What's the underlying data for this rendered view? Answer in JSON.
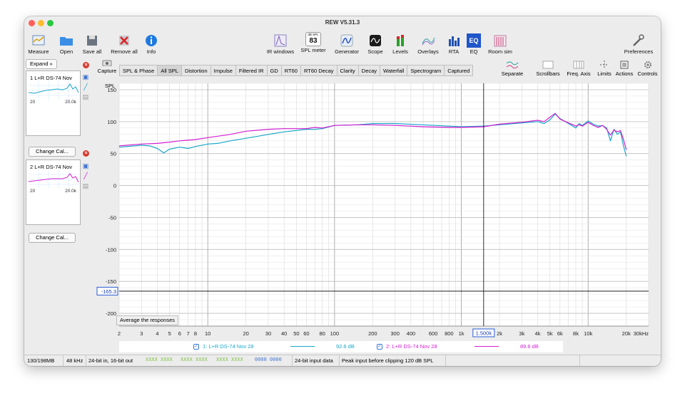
{
  "window": {
    "title": "REW V5.31.3"
  },
  "toolbar": {
    "measure": "Measure",
    "open": "Open",
    "save_all": "Save all",
    "remove_all": "Remove all",
    "info": "Info",
    "ir_windows": "IR windows",
    "spl_meter": "SPL meter",
    "spl_badge_label": "dB SPL",
    "spl_value": "83",
    "generator": "Generator",
    "scope": "Scope",
    "levels": "Levels",
    "overlays": "Overlays",
    "rta": "RTA",
    "eq": "EQ",
    "eq_icon_text": "EQ",
    "room_sim": "Room sim",
    "preferences": "Preferences"
  },
  "left_panel": {
    "expand": "Expand »",
    "measurements": [
      {
        "name": "1 L+R DS-74 Nov",
        "x_min": "20",
        "x_max": "20.0k",
        "change_cal": "Change Cal...",
        "color": "#1aa7c9"
      },
      {
        "name": "2 L+R DS-74 Nov",
        "x_min": "20",
        "x_max": "20.0k",
        "change_cal": "Change Cal...",
        "color": "#d21fd1"
      }
    ]
  },
  "tabs": {
    "capture": "Capture",
    "items": [
      "SPL & Phase",
      "All SPL",
      "Distortion",
      "Impulse",
      "Filtered IR",
      "GD",
      "RT60",
      "RT60 Decay",
      "Clarity",
      "Decay",
      "Waterfall",
      "Spectrogram",
      "Captured"
    ],
    "selected": "All SPL"
  },
  "right_tools": {
    "separate": "Separate",
    "scrollbars": "Scrollbars",
    "freq_axis": "Freq. Axis",
    "limits": "Limits",
    "actions": "Actions",
    "controls": "Controls"
  },
  "plot": {
    "y_axis_label": "SPL",
    "y_ticks": [
      "150",
      "100",
      "50",
      "0",
      "-50",
      "-100",
      "-150",
      "-200"
    ],
    "x_ticks": [
      "2",
      "3",
      "4",
      "5",
      "6",
      "7",
      "8",
      "10",
      "20",
      "30",
      "40",
      "50",
      "60",
      "80",
      "100",
      "200",
      "300",
      "400",
      "600",
      "800",
      "1k",
      "2k",
      "3k",
      "4k",
      "5k",
      "6k",
      "8k",
      "10k",
      "20k",
      "30kHz"
    ],
    "cursor_x_readout": "1.500k",
    "cursor_y_readout": "-165.3",
    "average_button": "Average the responses"
  },
  "chart_data": {
    "type": "line",
    "x_scale": "log",
    "xlim": [
      2,
      30000
    ],
    "ylim": [
      -220,
      160
    ],
    "xlabel": "",
    "ylabel": "SPL",
    "grid": true,
    "cursor": {
      "x": 1500,
      "y": -165.3
    },
    "series": [
      {
        "name": "1: L+R DS-74 Nov 28",
        "color": "#1aa7c9",
        "x": [
          2,
          3,
          3.5,
          4,
          4.5,
          5,
          6,
          7,
          8,
          10,
          12,
          15,
          20,
          30,
          40,
          60,
          70,
          80,
          100,
          150,
          200,
          300,
          500,
          800,
          1000,
          1500,
          2000,
          3000,
          4000,
          4500,
          5000,
          5500,
          6000,
          7000,
          8000,
          8500,
          9000,
          10000,
          11000,
          12000,
          13000,
          14000,
          15000,
          16000,
          17000,
          18000,
          19000,
          20000
        ],
        "y": [
          60,
          63,
          62,
          58,
          51,
          57,
          60,
          58,
          61,
          65,
          66,
          70,
          74,
          80,
          84,
          88,
          88,
          89,
          94,
          95,
          97,
          97,
          95,
          93,
          92,
          93,
          95,
          98,
          100,
          97,
          103,
          112,
          105,
          97,
          90,
          97,
          94,
          101,
          96,
          93,
          94,
          90,
          70,
          88,
          80,
          84,
          62,
          46
        ]
      },
      {
        "name": "2: L+R DS-74 Nov 28",
        "color": "#d21fd1",
        "x": [
          2,
          3,
          4,
          5,
          6,
          8,
          10,
          15,
          20,
          30,
          40,
          60,
          70,
          80,
          100,
          150,
          200,
          300,
          500,
          800,
          1000,
          1500,
          2000,
          3000,
          4000,
          4500,
          5000,
          5500,
          6000,
          7000,
          8000,
          8500,
          9000,
          10000,
          11000,
          12000,
          13000,
          14000,
          15000,
          16000,
          17000,
          18000,
          19000,
          20000
        ],
        "y": [
          62,
          65,
          66,
          68,
          70,
          72,
          75,
          80,
          85,
          88,
          89,
          89,
          91,
          90,
          94,
          95,
          95,
          94,
          92,
          91,
          91,
          92,
          96,
          99,
          102,
          100,
          107,
          113,
          104,
          98,
          93,
          95,
          93,
          99,
          94,
          91,
          94,
          88,
          79,
          87,
          84,
          86,
          72,
          56
        ]
      }
    ]
  },
  "legend": {
    "items": [
      {
        "label": "1: L+R DS-74 Nov 28",
        "value": "92.6 dB",
        "color": "#1aa7c9"
      },
      {
        "label": "2: L+R DS-74 Nov 28",
        "value": "89.6 dB",
        "color": "#d21fd1"
      }
    ]
  },
  "status_bar": {
    "memory": "130/198MB",
    "sample_rate": "48 kHz",
    "bit_depth": "24-bit in, 16-bit out",
    "input_meter_1": "XXXX XXXX",
    "input_meter_2": "XXXX XXXX",
    "input_meter_3": "XXXX XXXX",
    "input_meter_4": "0000 0000",
    "input_data": "24-bit input data",
    "clip_info": "Peak input before clipping 120 dB SPL"
  }
}
